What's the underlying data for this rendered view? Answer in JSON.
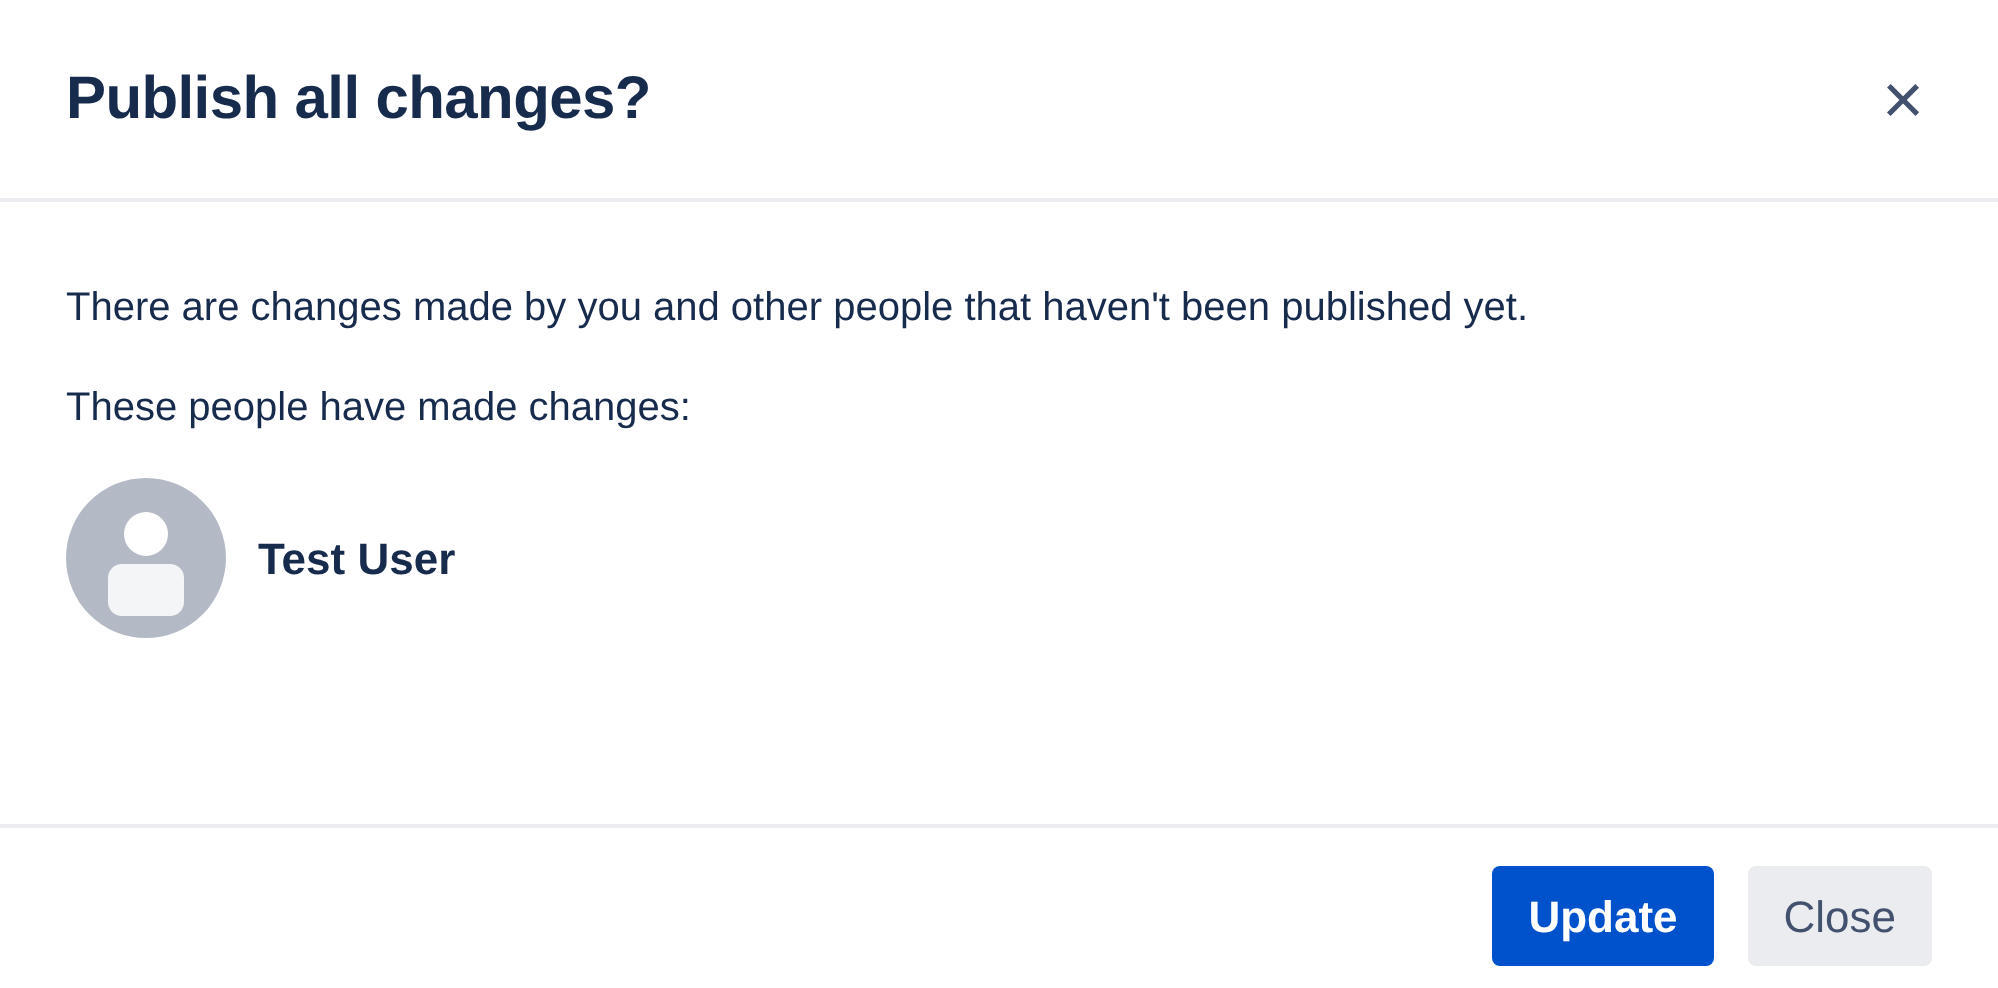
{
  "dialog": {
    "title": "Publish all changes?",
    "close_icon": "×"
  },
  "body": {
    "message": "There are changes made by you and other people that haven't been published yet.",
    "people_label": "These people have made changes:",
    "people": [
      {
        "name": "Test User"
      }
    ]
  },
  "buttons": [
    {
      "label": "Update",
      "kind": "primary"
    },
    {
      "label": "Close",
      "kind": "secondary"
    }
  ]
}
